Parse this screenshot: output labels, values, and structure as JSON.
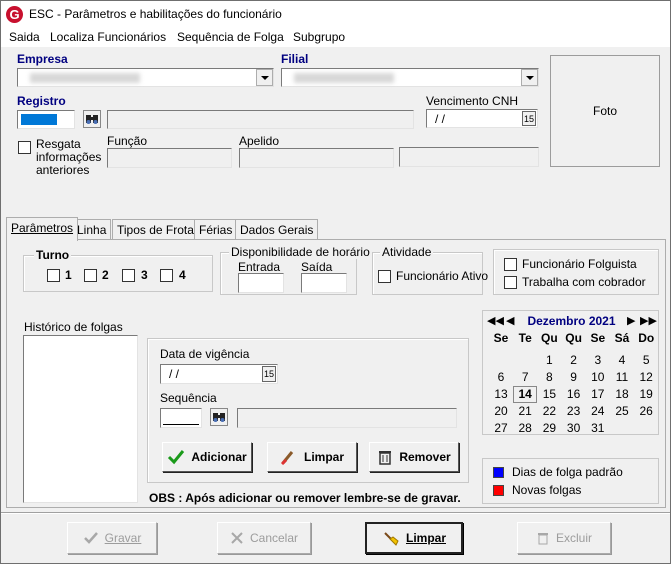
{
  "window": {
    "title": "ESC - Parâmetros e habilitações do funcionário",
    "logo_letter": "G"
  },
  "menu": [
    "Saida",
    "Localiza Funcionários",
    "Sequência de Folga",
    "Subgrupo"
  ],
  "header": {
    "empresa_label": "Empresa",
    "filial_label": "Filial",
    "registro_label": "Registro",
    "vencimento_label": "Vencimento  CNH",
    "vencimento_value": "/ /",
    "funcao_label": "Função",
    "apelido_label": "Apelido",
    "resgata_label": "Resgata informações anteriores",
    "foto_label": "Foto"
  },
  "tabs": [
    "Parâmetros",
    "Linha",
    "Tipos de Frota",
    "Férias",
    "Dados Gerais"
  ],
  "turno": {
    "label": "Turno",
    "options": [
      "1",
      "2",
      "3",
      "4"
    ]
  },
  "disponibilidade": {
    "label": "Disponibilidade de horário",
    "entrada": "Entrada",
    "saida": "Saída"
  },
  "atividade": {
    "label": "Atividade",
    "funcionario_ativo": "Funcionário Ativo"
  },
  "flags": {
    "folguista": "Funcionário Folguista",
    "cobrador": "Trabalha com cobrador"
  },
  "historico": {
    "label": "Histórico de folgas"
  },
  "vigencia": {
    "label": "Data de vigência",
    "value": "/ /",
    "sequencia_label": "Sequência"
  },
  "actions": {
    "adicionar": "Adicionar",
    "limpar": "Limpar",
    "remover": "Remover"
  },
  "obs": "OBS : Após adicionar ou  remover lembre-se de gravar.",
  "calendar": {
    "month": "Dezembro 2021",
    "weekdays": [
      "Se",
      "Te",
      "Qu",
      "Qu",
      "Se",
      "Sá",
      "Do"
    ],
    "weeks": [
      [
        "",
        "",
        "1",
        "2",
        "3",
        "4",
        "5"
      ],
      [
        "6",
        "7",
        "8",
        "9",
        "10",
        "11",
        "12"
      ],
      [
        "13",
        "14",
        "15",
        "16",
        "17",
        "18",
        "19"
      ],
      [
        "20",
        "21",
        "22",
        "23",
        "24",
        "25",
        "26"
      ],
      [
        "27",
        "28",
        "29",
        "30",
        "31",
        "",
        ""
      ]
    ],
    "selected": "14"
  },
  "legend": [
    {
      "label": "Dias de folga padrão",
      "color": "#0000ff"
    },
    {
      "label": "Novas folgas",
      "color": "#ff0000"
    }
  ],
  "footer": {
    "gravar": "Gravar",
    "cancelar": "Cancelar",
    "limpar": "Limpar",
    "excluir": "Excluir"
  }
}
